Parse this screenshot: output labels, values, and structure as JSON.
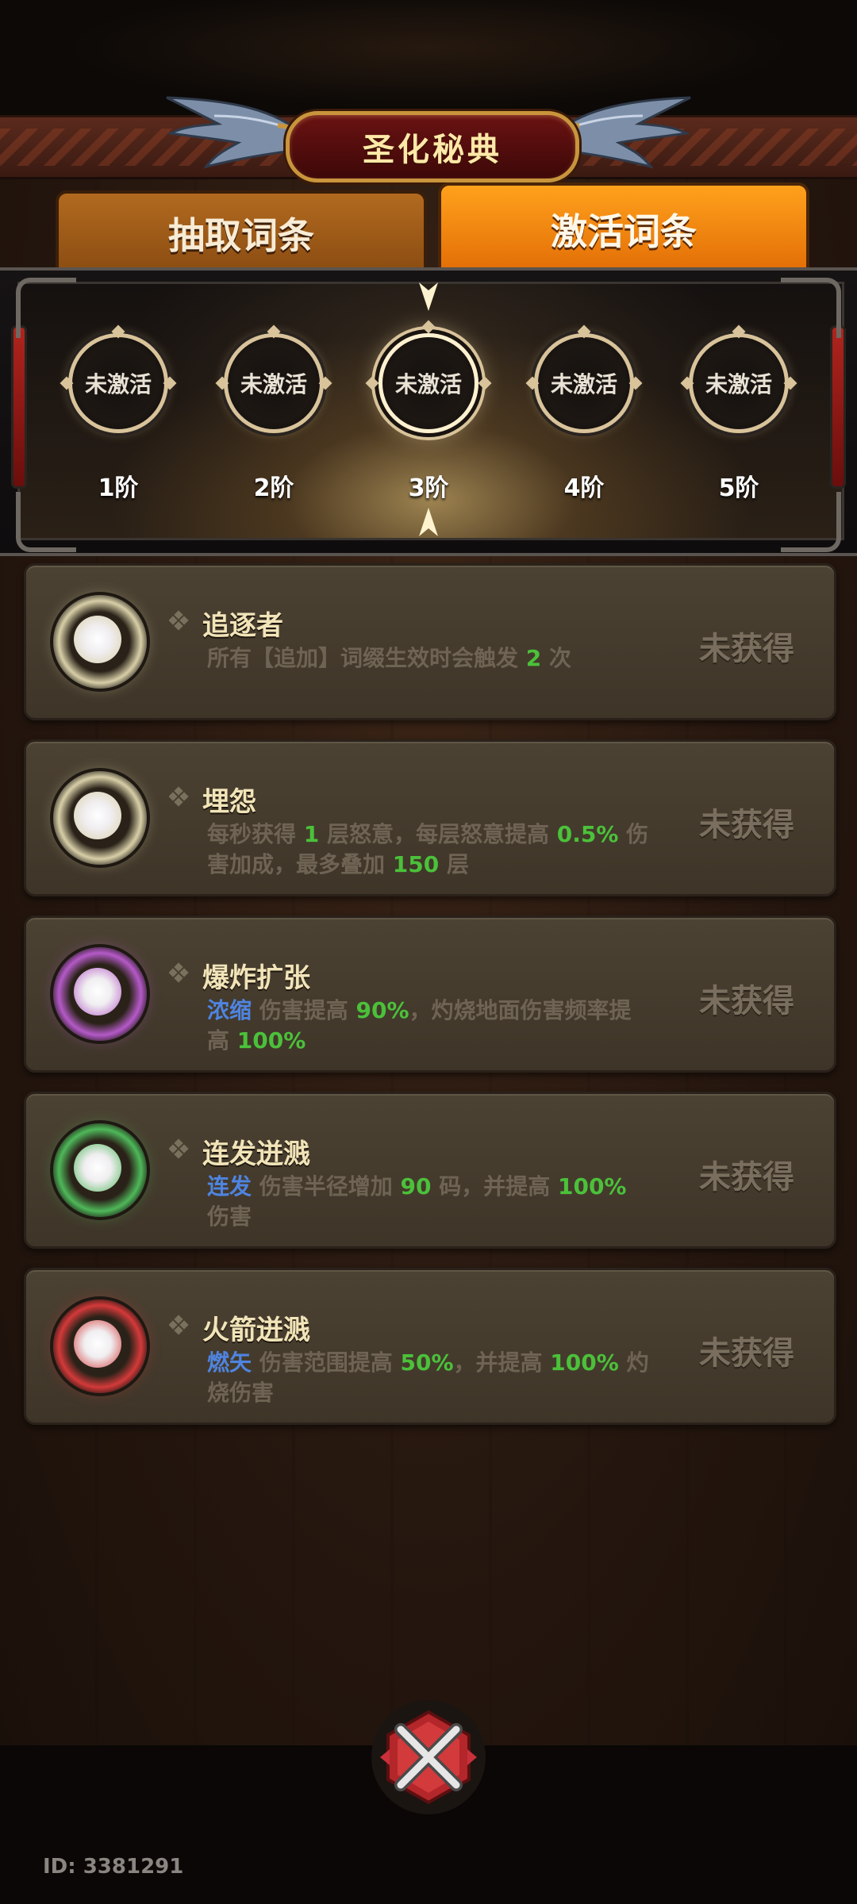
{
  "header": {
    "title": "圣化秘典"
  },
  "tabs": [
    {
      "label": "抽取词条",
      "active": false
    },
    {
      "label": "激活词条",
      "active": true
    }
  ],
  "tiers": [
    {
      "label": "1阶",
      "state": "未激活"
    },
    {
      "label": "2阶",
      "state": "未激活"
    },
    {
      "label": "3阶",
      "state": "未激活",
      "selected": true
    },
    {
      "label": "4阶",
      "state": "未激活"
    },
    {
      "label": "5阶",
      "state": "未激活"
    }
  ],
  "entries": [
    {
      "name": "追逐者",
      "orb_color": "#d8cfa8",
      "desc": [
        [
          "所有【追加】词缀生效时会触发 ",
          ""
        ],
        [
          "2",
          "g"
        ],
        [
          " 次",
          ""
        ]
      ],
      "status": "未获得"
    },
    {
      "name": "埋怨",
      "orb_color": "#d8cfa8",
      "desc": [
        [
          "每秒获得 ",
          ""
        ],
        [
          "1",
          "g"
        ],
        [
          " 层怒意，每层怒意提高 ",
          ""
        ],
        [
          "0.5%",
          "g"
        ],
        [
          " 伤害加成，最多叠加 ",
          ""
        ],
        [
          "150",
          "g"
        ],
        [
          " 层",
          ""
        ]
      ],
      "status": "未获得"
    },
    {
      "name": "爆炸扩张",
      "orb_color": "#b55ac8",
      "desc": [
        [
          "浓缩",
          "b"
        ],
        [
          " 伤害提高 ",
          ""
        ],
        [
          "90%",
          "g"
        ],
        [
          "，灼烧地面伤害频率提高 ",
          ""
        ],
        [
          "100%",
          "g"
        ]
      ],
      "status": "未获得"
    },
    {
      "name": "连发迸溅",
      "orb_color": "#4fb85a",
      "desc": [
        [
          "连发",
          "b"
        ],
        [
          " 伤害半径增加 ",
          ""
        ],
        [
          "90",
          "g"
        ],
        [
          " 码，并提高 ",
          ""
        ],
        [
          "100%",
          "g"
        ],
        [
          " 伤害",
          ""
        ]
      ],
      "status": "未获得"
    },
    {
      "name": "火箭迸溅",
      "orb_color": "#d33a3a",
      "desc": [
        [
          "燃矢",
          "b"
        ],
        [
          " 伤害范围提高 ",
          ""
        ],
        [
          "50%",
          "g"
        ],
        [
          "，并提高 ",
          ""
        ],
        [
          "100%",
          "g"
        ],
        [
          " 灼烧伤害",
          ""
        ]
      ],
      "status": "未获得"
    }
  ],
  "footer": {
    "id_text": "ID: 3381291",
    "close_icon": "close-x-icon"
  },
  "colors": {
    "highlight_green": "#4bc13a",
    "keyword_blue": "#4f84e0",
    "active_tab": "#ff9a12"
  }
}
